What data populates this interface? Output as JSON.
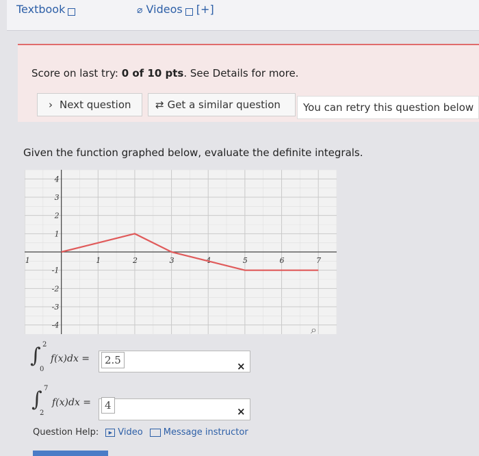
{
  "topbar": {
    "textbook_label": "Textbook",
    "videos_label": "Videos",
    "plus_label": "[+]"
  },
  "score": {
    "prefix": "Score on last try: ",
    "value": "0 of 10 pts",
    "suffix": ". See Details for more."
  },
  "actions": {
    "next_label": "Next question",
    "similar_label": "Get a similar question",
    "retry_text": "You can retry this question below"
  },
  "question_text": "Given the function graphed below, evaluate the definite integrals.",
  "chart_data": {
    "type": "line",
    "x": [
      0,
      2,
      3,
      4,
      5,
      6,
      7
    ],
    "y": [
      0,
      1,
      0,
      -0.5,
      -1,
      -1,
      -1
    ],
    "xlim": [
      -1,
      7.5
    ],
    "ylim": [
      -4.5,
      4.5
    ],
    "x_ticks": [
      "-1",
      "1",
      "2",
      "3",
      "4",
      "5",
      "6",
      "7"
    ],
    "y_ticks": [
      "4",
      "3",
      "2",
      "1",
      "-1",
      "-2",
      "-3",
      "-4"
    ],
    "grid": true,
    "line_color": "#e05a5a"
  },
  "integrals": [
    {
      "lower": "0",
      "upper": "2",
      "expr": "f(x)dx =",
      "answer": "2.5",
      "status": "×"
    },
    {
      "lower": "2",
      "upper": "7",
      "expr": "f(x)dx =",
      "answer": "4",
      "status": "×"
    }
  ],
  "help": {
    "label": "Question Help:",
    "video_label": "Video",
    "message_label": "Message instructor"
  },
  "colors": {
    "accent": "#2d5fa7",
    "error_line": "#e06b6b",
    "graph_line": "#e05a5a"
  }
}
